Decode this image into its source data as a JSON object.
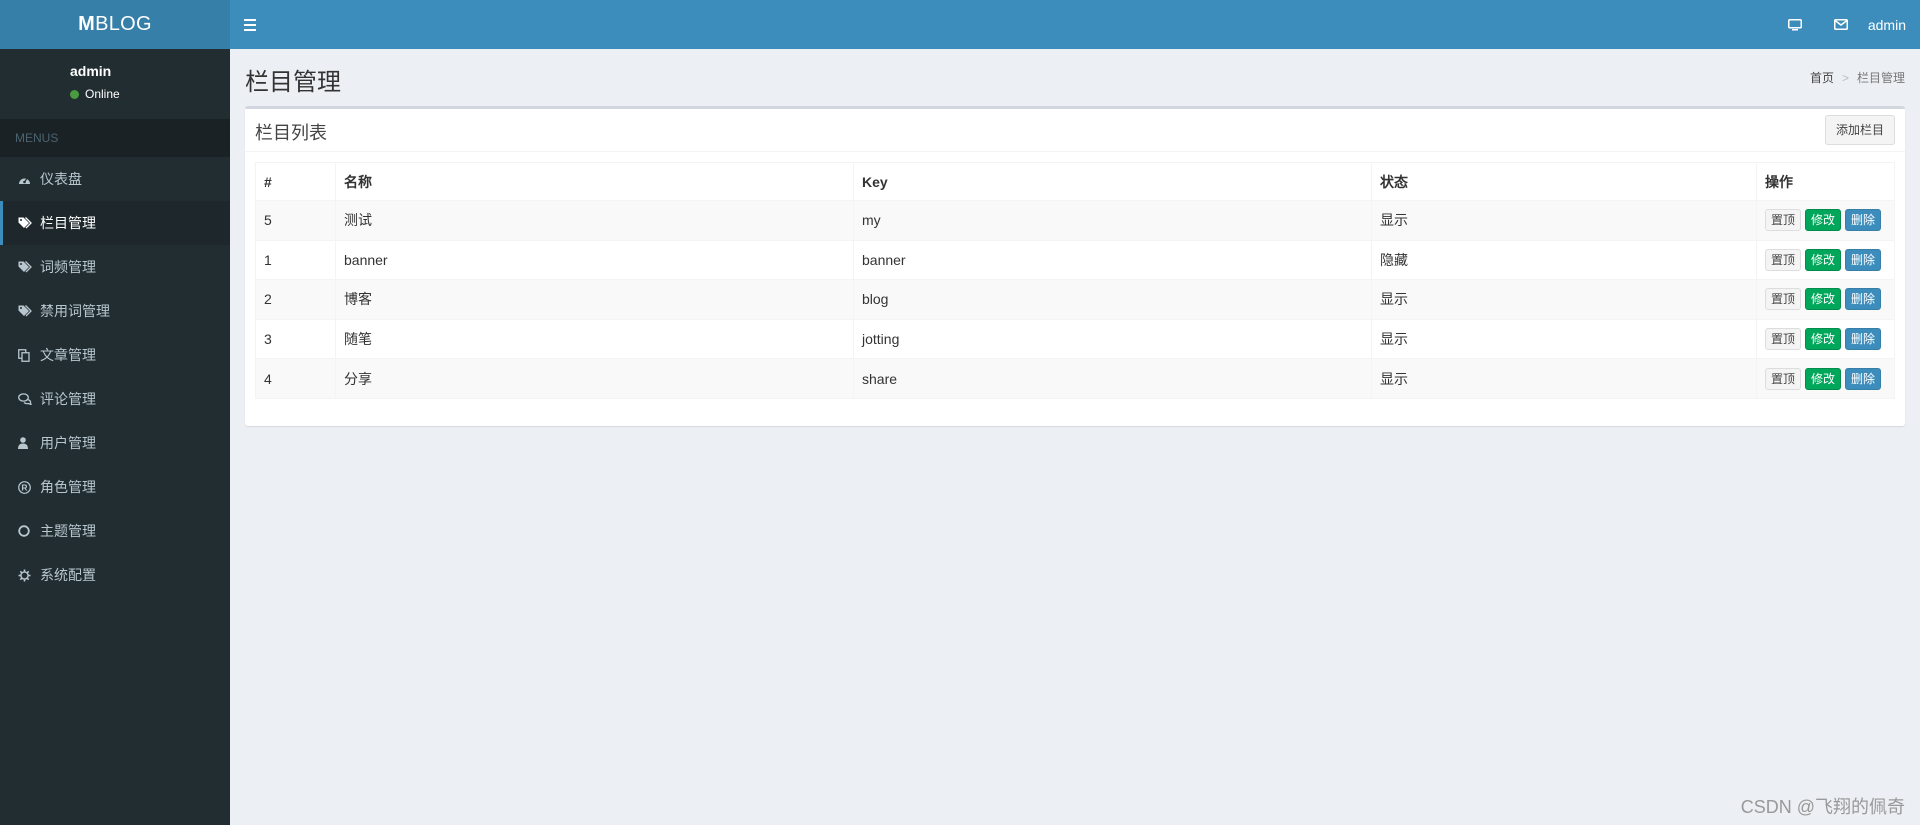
{
  "brand": {
    "prefix": "M",
    "rest": "BLOG"
  },
  "topbar": {
    "username": "admin",
    "icons": [
      "monitor-icon",
      "envelope-icon"
    ]
  },
  "sidebar": {
    "user": {
      "name": "admin",
      "status": "Online"
    },
    "menu_header": "MENUS",
    "items": [
      {
        "label": "仪表盘",
        "icon": "dashboard-icon"
      },
      {
        "label": "栏目管理",
        "icon": "tags-icon",
        "active": true
      },
      {
        "label": "词频管理",
        "icon": "tags-icon"
      },
      {
        "label": "禁用词管理",
        "icon": "tags-icon"
      },
      {
        "label": "文章管理",
        "icon": "copy-icon"
      },
      {
        "label": "评论管理",
        "icon": "comments-icon"
      },
      {
        "label": "用户管理",
        "icon": "user-icon"
      },
      {
        "label": "角色管理",
        "icon": "registered-icon"
      },
      {
        "label": "主题管理",
        "icon": "circle-icon"
      },
      {
        "label": "系统配置",
        "icon": "gear-icon"
      }
    ]
  },
  "page": {
    "title": "栏目管理",
    "breadcrumb": {
      "home": "首页",
      "sep": ">",
      "current": "栏目管理"
    }
  },
  "box": {
    "title": "栏目列表",
    "add_button": "添加栏目",
    "columns": [
      "#",
      "名称",
      "Key",
      "状态",
      "操作"
    ],
    "rows": [
      {
        "id": "5",
        "name": "测试",
        "key": "my",
        "status": "显示"
      },
      {
        "id": "1",
        "name": "banner",
        "key": "banner",
        "status": "隐藏"
      },
      {
        "id": "2",
        "name": "博客",
        "key": "blog",
        "status": "显示"
      },
      {
        "id": "3",
        "name": "随笔",
        "key": "jotting",
        "status": "显示"
      },
      {
        "id": "4",
        "name": "分享",
        "key": "share",
        "status": "显示"
      }
    ],
    "actions": {
      "top": "置顶",
      "edit": "修改",
      "delete": "删除"
    }
  },
  "watermark": "CSDN @飞翔的佩奇",
  "colors": {
    "header": "#3c8dbc",
    "logo_bg": "#367fa9",
    "sidebar": "#222d32",
    "edit": "#00a65a",
    "delete": "#3c8dbc"
  }
}
